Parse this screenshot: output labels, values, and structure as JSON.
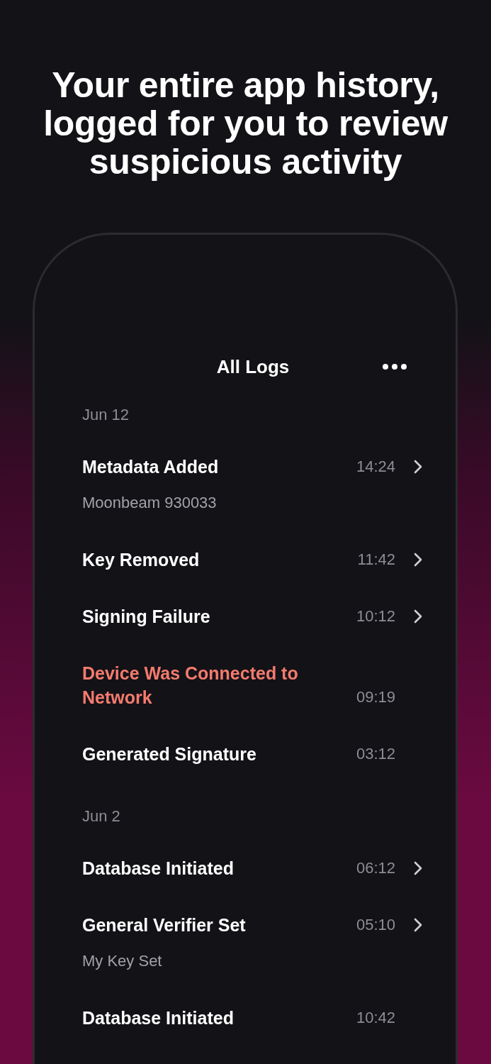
{
  "headline": "Your entire app history, logged for you to review suspicious activity",
  "screen": {
    "title": "All Logs",
    "groups": [
      {
        "date": "Jun 12",
        "entries": [
          {
            "title": "Metadata Added",
            "subtitle": "Moonbeam 930033",
            "time": "14:24",
            "alert": false,
            "chevron": true
          },
          {
            "title": "Key Removed",
            "time": "11:42",
            "alert": false,
            "chevron": true
          },
          {
            "title": "Signing Failure",
            "time": "10:12",
            "alert": false,
            "chevron": true
          },
          {
            "title": "Device Was Connected to Network",
            "time": "09:19",
            "alert": true,
            "chevron": false
          },
          {
            "title": "Generated Signature",
            "time": "03:12",
            "alert": false,
            "chevron": false
          }
        ]
      },
      {
        "date": "Jun 2",
        "entries": [
          {
            "title": "Database Initiated",
            "time": "06:12",
            "alert": false,
            "chevron": true
          },
          {
            "title": "General Verifier Set",
            "subtitle": "My Key Set",
            "time": "05:10",
            "alert": false,
            "chevron": true
          },
          {
            "title": "Database Initiated",
            "time": "10:42",
            "alert": false,
            "chevron": false
          }
        ]
      }
    ]
  }
}
